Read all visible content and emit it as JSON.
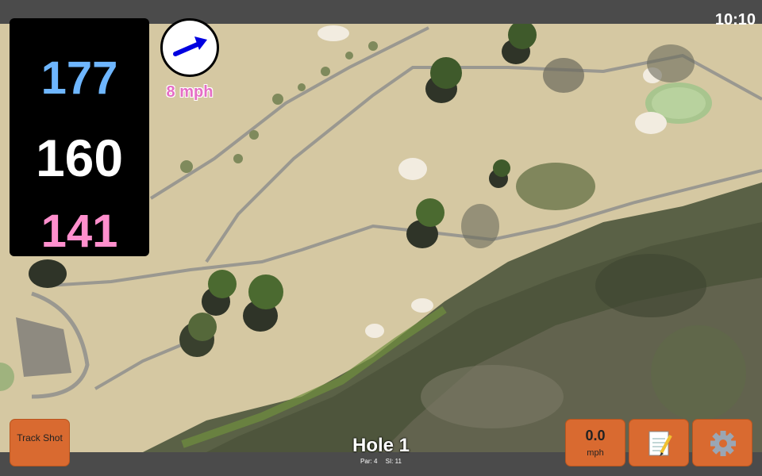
{
  "status": {
    "time": "10:10"
  },
  "yardages": {
    "back": "177",
    "center": "160",
    "front": "141"
  },
  "wind": {
    "speed": "8 mph",
    "icon": "wind-direction-arrow-icon"
  },
  "hole": {
    "title": "Hole 1",
    "par": "Par: 4",
    "si": "SI: 11"
  },
  "buttons": {
    "track_shot": "Track Shot",
    "speed_value": "0.0",
    "speed_unit": "mph",
    "notes_icon": "notepad-icon",
    "settings_icon": "gear-icon"
  },
  "colors": {
    "back_yardage": "#6eb6ff",
    "center_yardage": "#ffffff",
    "front_yardage": "#ff8fcd",
    "wind_text": "#e56ec5",
    "button": "#d96a30"
  }
}
